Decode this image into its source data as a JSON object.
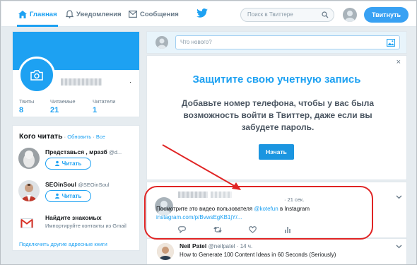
{
  "nav": {
    "home_label": "Главная",
    "notifications_label": "Уведомления",
    "messages_label": "Сообщения",
    "search_placeholder": "Поиск в Твиттере",
    "tweet_button": "Твитнуть"
  },
  "profile": {
    "name_dot": "·",
    "stats": [
      {
        "label": "Твиты",
        "value": "8"
      },
      {
        "label": "Читаемые",
        "value": "21"
      },
      {
        "label": "Читатели",
        "value": "1"
      }
    ]
  },
  "who_to_follow": {
    "title": "Кого читать",
    "separator1": " · ",
    "refresh": "Обновить",
    "separator2": " · ",
    "all": "Все",
    "accounts": [
      {
        "name": "Представься , мразб",
        "handle": "@d...",
        "button": "Читать"
      },
      {
        "name": "SEOinSoul",
        "handle": "@SEOinSoul",
        "button": "Читать"
      }
    ],
    "contacts_title": "Найдите знакомых",
    "contacts_sub": "Импортируйте контакты из Gmail",
    "footer_link": "Подключить другие адресные книги"
  },
  "compose": {
    "placeholder": "Что нового?"
  },
  "promo": {
    "title": "Защитите свою учетную запись",
    "text": "Добавьте номер телефона, чтобы у вас была возможность войти в Твиттер, даже если вы забудете пароль.",
    "button": "Начать",
    "close": "×"
  },
  "tweet": {
    "time": "· 21 сек.",
    "text_before": "Посмотрите это видео пользователя ",
    "mention": "@kotefun",
    "text_after": " в Instagram",
    "link": "instagram.com/p/BvwsEgKB1jY/..."
  },
  "tweet2": {
    "name": "Neil Patel",
    "handle": "@neilpatel · 14 ч.",
    "text": "How to Generate 100 Content Ideas in 60 Seconds (Seriously)"
  },
  "colors": {
    "accent": "#1da1f2",
    "annotation": "#e02424"
  }
}
